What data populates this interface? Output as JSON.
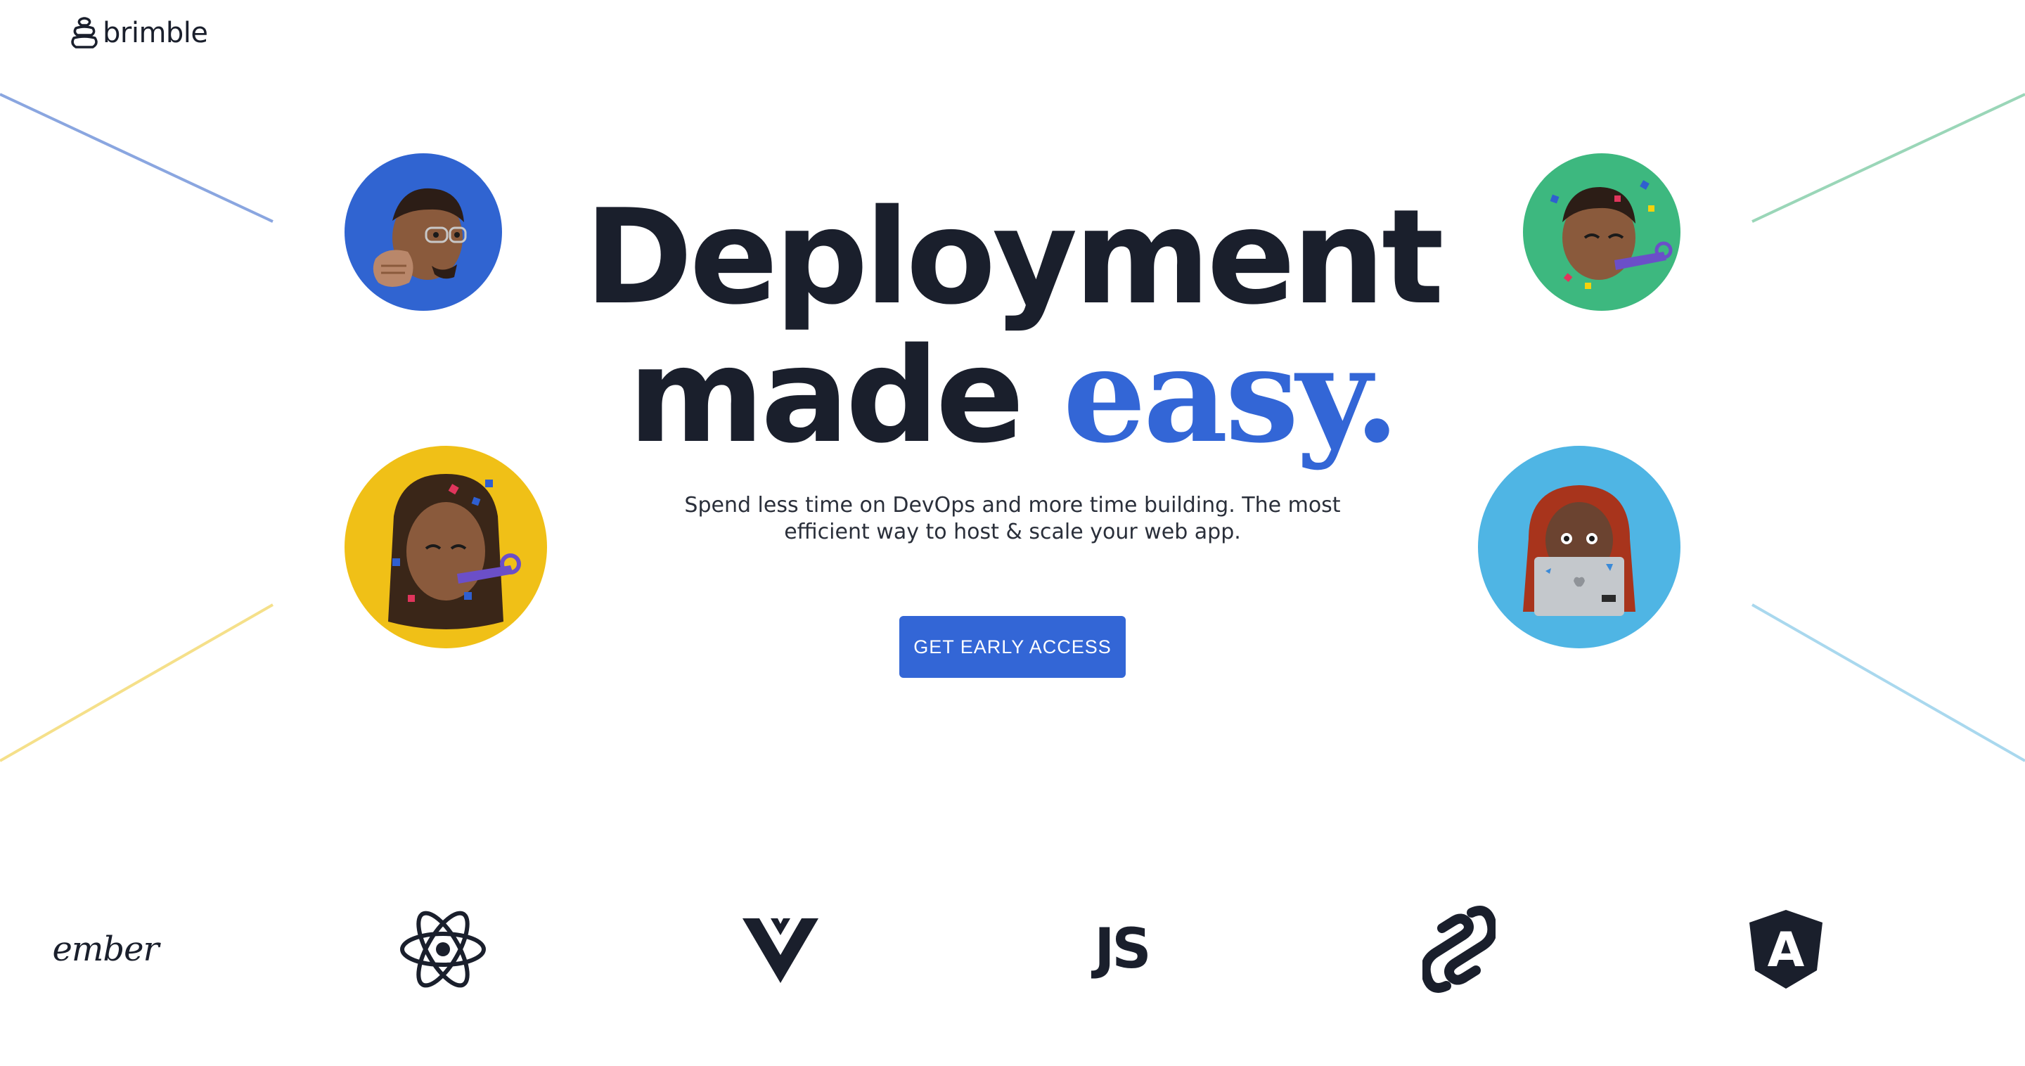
{
  "brand": {
    "name": "brimble",
    "logo_icon": "brimble-logo-icon"
  },
  "hero": {
    "title_line1": "Deployment",
    "title_line2_main": "made",
    "title_line2_accent": "easy.",
    "subtitle": "Spend less time on DevOps and more time building. The most efficient way to host & scale your web app.",
    "cta_label": "GET EARLY ACCESS"
  },
  "avatars": [
    {
      "name": "memoji-fist-bump",
      "color": "#3064d1"
    },
    {
      "name": "memoji-party-horn",
      "color": "#3db87f"
    },
    {
      "name": "memoji-celebrating",
      "color": "#f0c017"
    },
    {
      "name": "memoji-laptop",
      "color": "#4fb5e4"
    }
  ],
  "frameworks": [
    {
      "name": "ember",
      "label": "ember",
      "icon": "ember-logo-icon"
    },
    {
      "name": "react",
      "label": "",
      "icon": "react-logo-icon"
    },
    {
      "name": "vue",
      "label": "",
      "icon": "vue-logo-icon"
    },
    {
      "name": "javascript",
      "label": "JS",
      "icon": "js-logo-icon"
    },
    {
      "name": "svelte",
      "label": "",
      "icon": "svelte-logo-icon"
    },
    {
      "name": "angular",
      "label": "A",
      "icon": "angular-logo-icon"
    }
  ],
  "colors": {
    "accent": "#3366d6",
    "text": "#1a1f2c",
    "line_top_left": "#8aa6e0",
    "line_top_right": "#9ad6b8",
    "line_bottom_left": "#f5e08a",
    "line_bottom_right": "#a9d8ee"
  }
}
